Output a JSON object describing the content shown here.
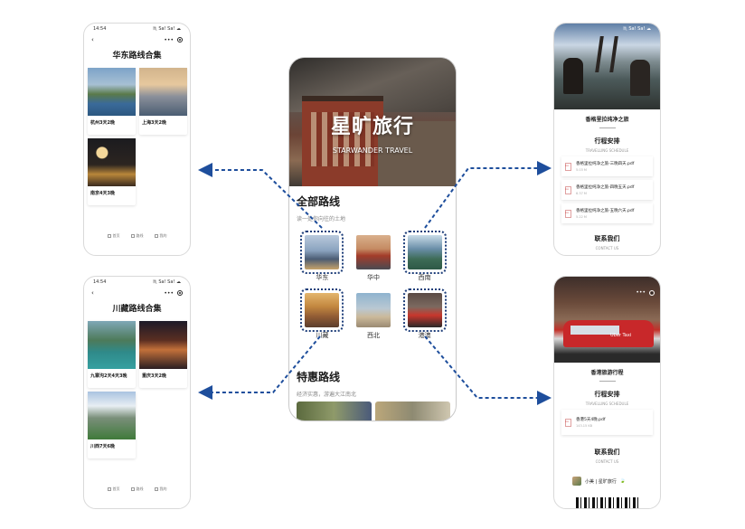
{
  "status_time": "14:54",
  "status_icons": "♏ Sa! Sa! ☁",
  "nav_capsule": "•••",
  "center": {
    "hero_title": "星旷旅行",
    "hero_subtitle": "STARWANDER TRAVEL",
    "all_routes_title": "全部路线",
    "all_routes_sub": "读一处你向往的土地",
    "regions": [
      "华东",
      "华中",
      "西南",
      "川藏",
      "西北",
      "港澳"
    ],
    "deals_title": "特惠路线",
    "deals_sub": "经济实惠，游遍大江南北"
  },
  "east": {
    "title": "华东路线合集",
    "cards": [
      "杭州3天2晚",
      "上海3天2晚",
      "南京4天3晚"
    ]
  },
  "sichuan": {
    "title": "川藏路线合集",
    "cards": [
      "九寨沟2天4天3晚",
      "重庆3天2晚",
      "川西7天6晚"
    ]
  },
  "tabbar": [
    "首页",
    "路线",
    "我的"
  ],
  "shangri": {
    "title": "香格里拉纯净之旅",
    "sched_title": "行程安排",
    "sched_sub": "TRAVELLING SCHEDULE",
    "files": [
      {
        "name": "香格里拉纯净之旅-三晚四天.pdf",
        "size": "5.03 M"
      },
      {
        "name": "香格里拉纯净之旅-四晚五天.pdf",
        "size": "6.37 M"
      },
      {
        "name": "香格里拉纯净之旅-五晚六天.pdf",
        "size": "5.22 M"
      }
    ],
    "contact_title": "联系我们",
    "contact_sub": "CONTACT US"
  },
  "hongkong": {
    "title": "香港旅游行程",
    "sched_title": "行程安排",
    "sched_sub": "TRAVELLING SCHEDULE",
    "files": [
      {
        "name": "香港5天4晚.pdf",
        "size": "143.15 KB"
      }
    ],
    "contact_title": "联系我们",
    "contact_sub": "CONTACT US",
    "contact_name": "小美 | 星旷旅行",
    "taxi_sign": "Uber Taxi"
  },
  "colors": {
    "arrow": "#1e4e9c",
    "selection": "#1f3f7a"
  }
}
